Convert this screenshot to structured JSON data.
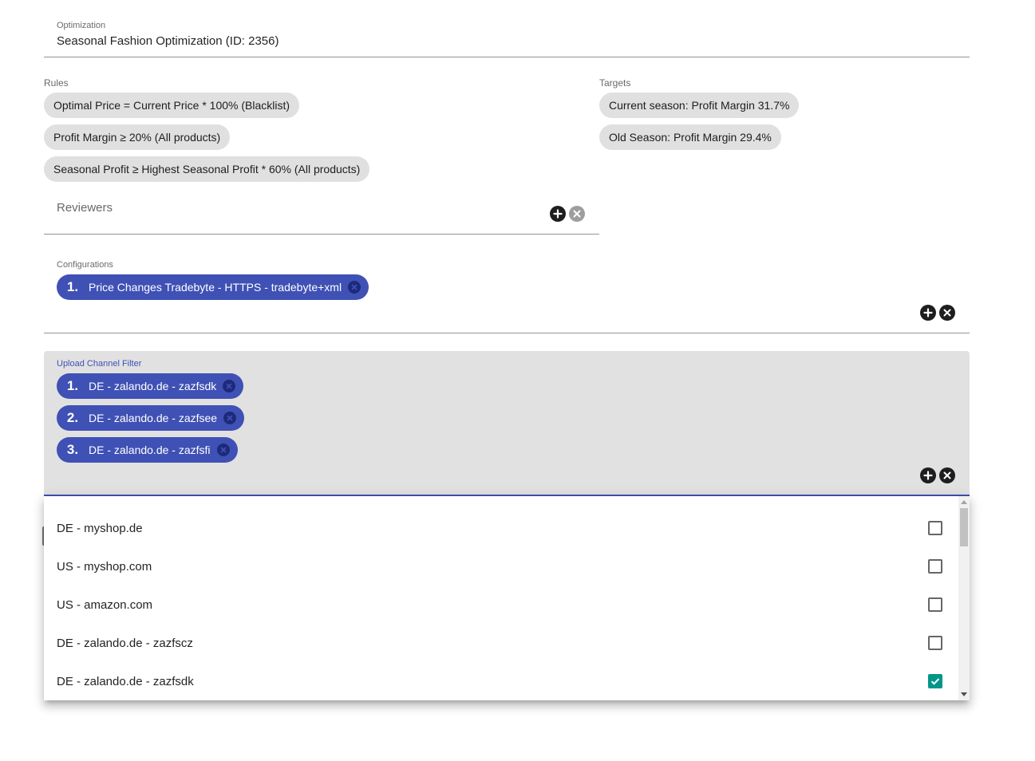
{
  "optimization": {
    "label": "Optimization",
    "value": "Seasonal Fashion Optimization (ID: 2356)"
  },
  "rules": {
    "label": "Rules",
    "items": [
      "Optimal Price = Current Price * 100% (Blacklist)",
      "Profit Margin ≥ 20% (All products)",
      "Seasonal Profit ≥ Highest Seasonal Profit * 60% (All products)"
    ]
  },
  "targets": {
    "label": "Targets",
    "items": [
      "Current season: Profit Margin 31.7%",
      "Old Season: Profit Margin 29.4%"
    ]
  },
  "reviewers": {
    "label": "Reviewers",
    "add_icon": "add-circle-icon",
    "clear_icon": "close-circle-icon"
  },
  "configurations": {
    "label": "Configurations",
    "chips": [
      {
        "number": "1.",
        "label": "Price Changes Tradebyte - HTTPS - tradebyte+xml"
      }
    ]
  },
  "upload_channel_filter": {
    "label": "Upload Channel Filter",
    "chips": [
      {
        "number": "1.",
        "label": "DE - zalando.de - zazfsdk"
      },
      {
        "number": "2.",
        "label": "DE - zalando.de - zazfsee"
      },
      {
        "number": "3.",
        "label": "DE - zalando.de - zazfsfi"
      }
    ]
  },
  "dropdown": {
    "options": [
      {
        "label": "DE - myshop.de",
        "checked": false
      },
      {
        "label": "US - myshop.com",
        "checked": false
      },
      {
        "label": "US - amazon.com",
        "checked": false
      },
      {
        "label": "DE - zalando.de - zazfscz",
        "checked": false
      },
      {
        "label": "DE - zalando.de - zazfsdk",
        "checked": true
      }
    ]
  },
  "colors": {
    "primary": "#3f51b5",
    "chip_gray": "#e0e0e0",
    "checkbox_checked": "#009688"
  }
}
